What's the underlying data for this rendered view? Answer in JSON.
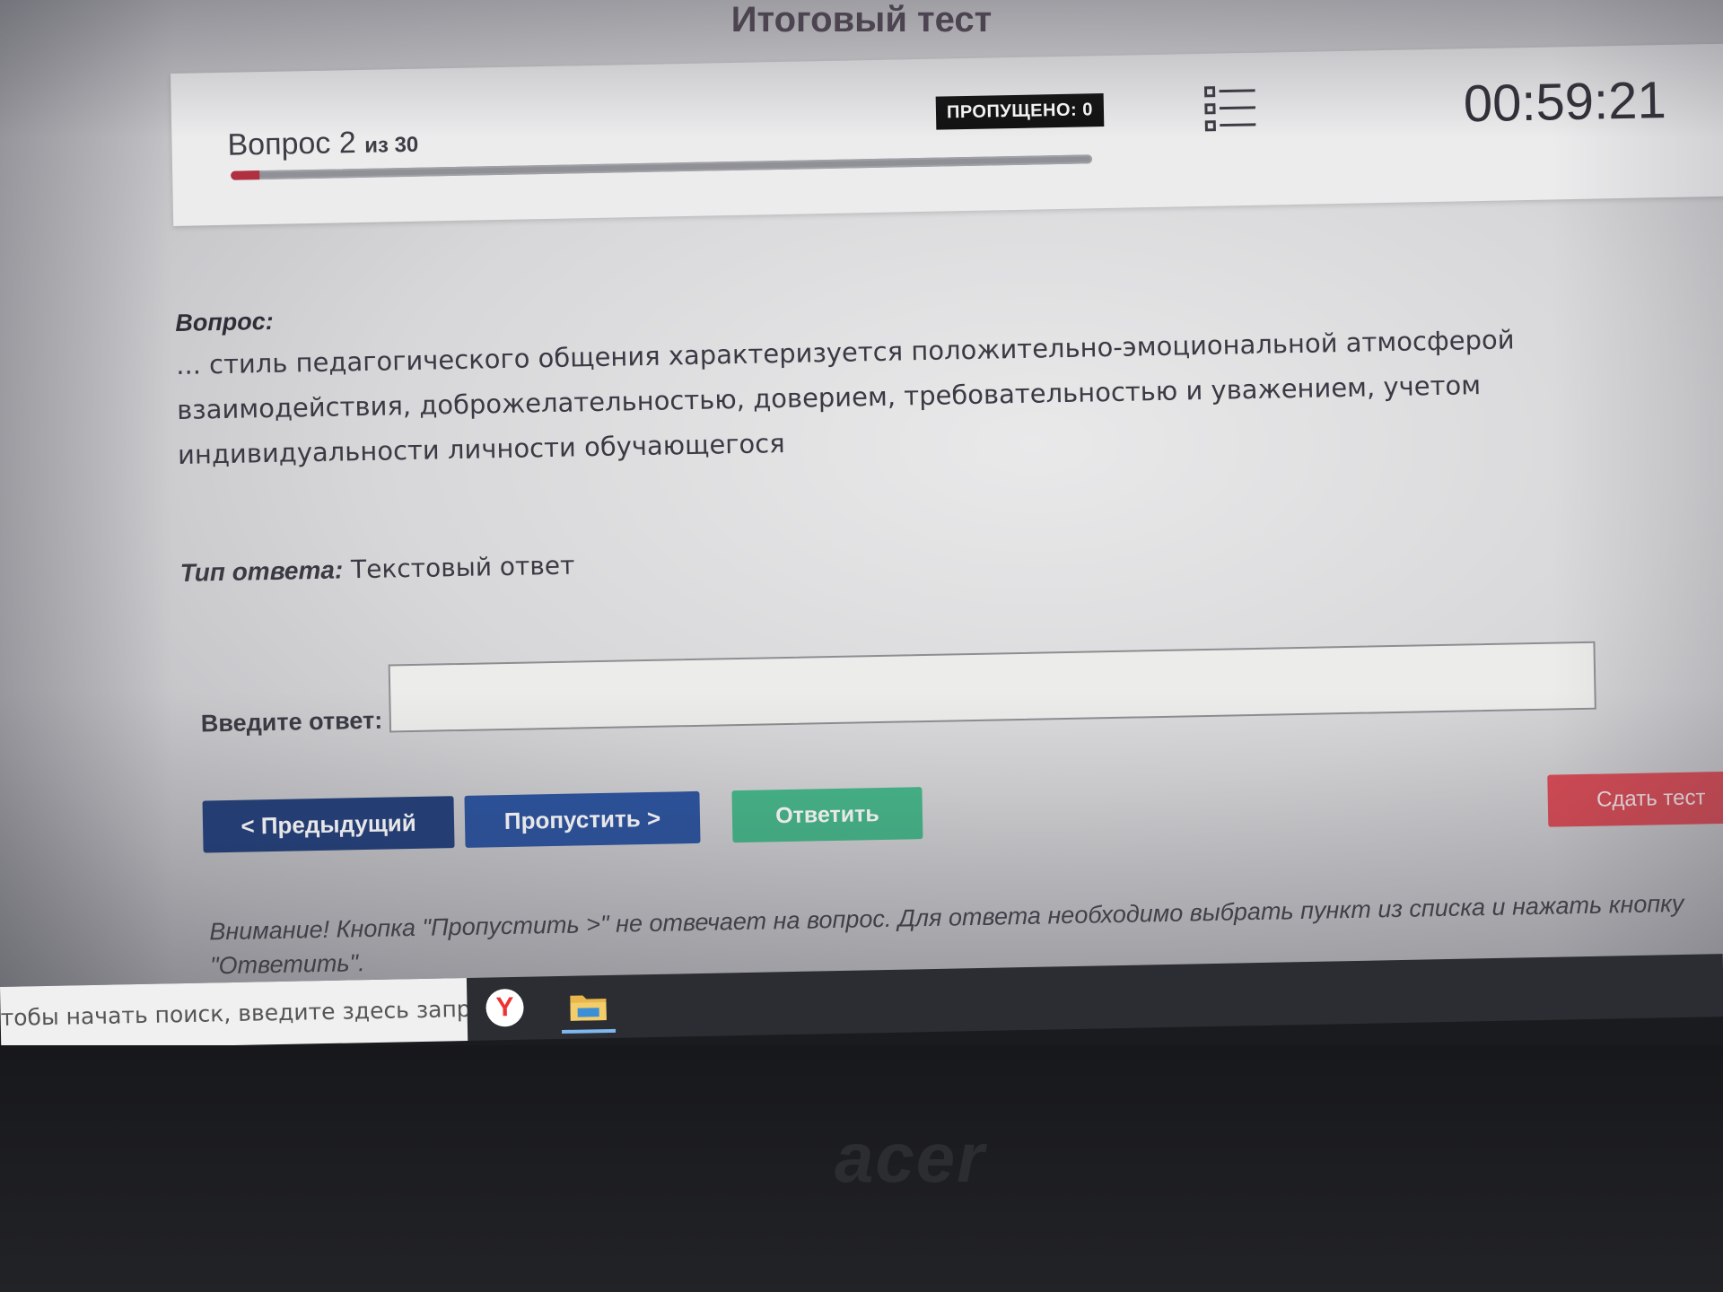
{
  "page": {
    "title": "Итоговый тест"
  },
  "header": {
    "question_prefix": "Вопрос 2",
    "question_suffix": "из 30",
    "progress_fraction": 0.033,
    "skipped_badge": "ПРОПУЩЕНО: 0",
    "timer": "00:59:21",
    "list_icon": "question-list-icon"
  },
  "question": {
    "label": "Вопрос:",
    "text": "... стиль педагогического общения характеризуется положительно-эмоциональной атмосферой взаимодействия, доброжелательностью, доверием, требовательностью и уважением, учетом индивидуальности личности обучающегося"
  },
  "answer_type": {
    "label": "Тип ответа:",
    "value": "Текстовый ответ"
  },
  "answer_input": {
    "label": "Введите ответ:",
    "value": ""
  },
  "buttons": {
    "prev": "< Предыдущий",
    "skip": "Пропустить >",
    "answer": "Ответить",
    "submit": "Сдать тест"
  },
  "warning": "Внимание! Кнопка \"Пропустить >\" не отвечает на вопрос. Для ответа необходимо выбрать пункт из списка и нажать кнопку \"Ответить\".",
  "taskbar": {
    "search_placeholder": "тобы начать поиск, введите здесь запрос",
    "apps": [
      "yandex-browser-icon",
      "file-explorer-icon"
    ]
  },
  "monitor": {
    "brand": "acer"
  },
  "colors": {
    "progress": "#b13040",
    "prev_button": "#24407b",
    "skip_button": "#2d54a0",
    "answer_button": "#46b88a",
    "submit_button": "#d94b55"
  }
}
